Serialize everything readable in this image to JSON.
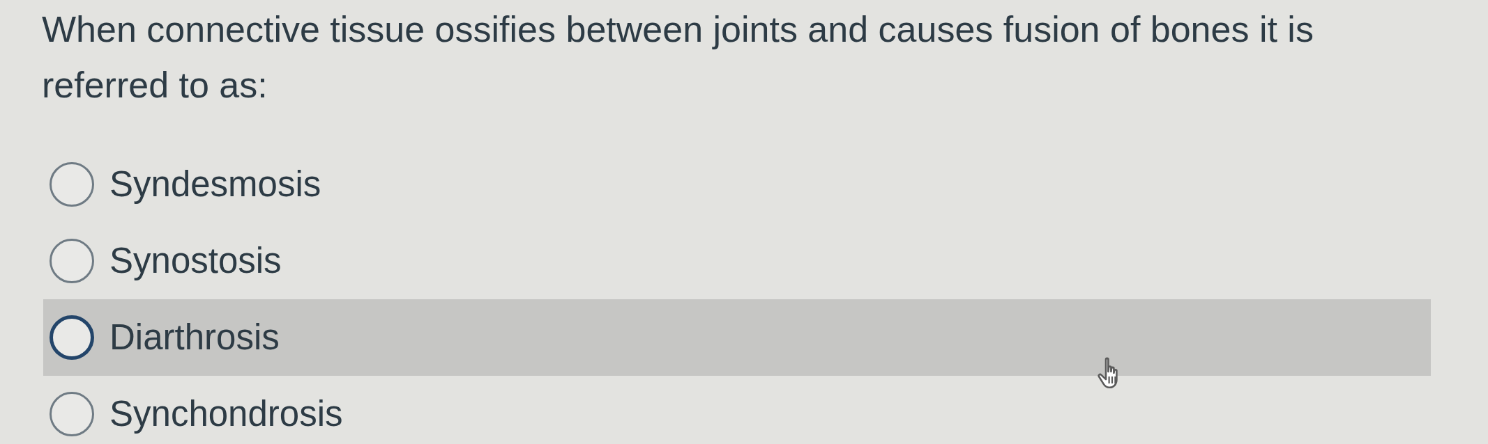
{
  "question": {
    "text": "When connective tissue ossifies between joints and causes fusion of bones it is referred to as:"
  },
  "options": [
    {
      "label": "Syndesmosis",
      "selected": false,
      "hovered": false
    },
    {
      "label": "Synostosis",
      "selected": false,
      "hovered": false
    },
    {
      "label": "Diarthrosis",
      "selected": false,
      "hovered": true
    },
    {
      "label": "Synchondrosis",
      "selected": false,
      "hovered": false
    }
  ]
}
